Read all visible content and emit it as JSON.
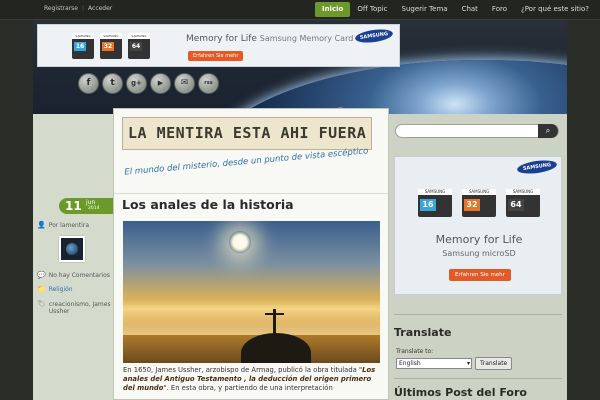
{
  "topbar": {
    "auth": [
      "Registrarse",
      "Acceder"
    ],
    "nav": [
      {
        "label": "Inicio",
        "active": true
      },
      {
        "label": "Off Topic",
        "active": false
      },
      {
        "label": "Sugerir Tema",
        "active": false
      },
      {
        "label": "Chat",
        "active": false
      },
      {
        "label": "Foro",
        "active": false
      },
      {
        "label": "¿Por qué este sitio?",
        "active": false
      }
    ]
  },
  "header_ad": {
    "cards": [
      "16",
      "32",
      "64"
    ],
    "headline": "Memory for Life",
    "subhead": "Samsung Memory Card",
    "button": "Erfahren Sie mehr",
    "brand": "SAMSUNG"
  },
  "social": [
    "f",
    "t",
    "g+",
    "▶",
    "✉",
    "rss"
  ],
  "site": {
    "banner": "LA MENTIRA ESTA AHI FUERA",
    "tagline": "El mundo del misterio, desde un punto de vista escéptico"
  },
  "post": {
    "title": "Los anales de la historia",
    "date": {
      "day": "11",
      "month": "jun",
      "year": "2014"
    },
    "author": "Por lamentira",
    "comments": "No hay Comentarios",
    "category": "Religión",
    "tags": "creacionismo, James Ussher",
    "body_start": "En 1650, James Ussher, arzobispo de Armag, publicó la obra titulada \"",
    "body_italic": "Los anales del Antiguo Testamento , la deducción del origen primero del mundo",
    "body_end": "\". En esta obra, y partiendo de una interpretación"
  },
  "sidebar": {
    "search_placeholder": "",
    "ad": {
      "brand": "SAMSUNG",
      "cards": [
        "16",
        "32",
        "64"
      ],
      "headline": "Memory for Life",
      "subhead": "Samsung microSD",
      "button": "Erfahren Sie mehr"
    },
    "translate_title": "Translate",
    "translate_label": "Translate to:",
    "language": "English",
    "translate_button": "Translate",
    "forum_title": "Últimos Post del Foro"
  }
}
